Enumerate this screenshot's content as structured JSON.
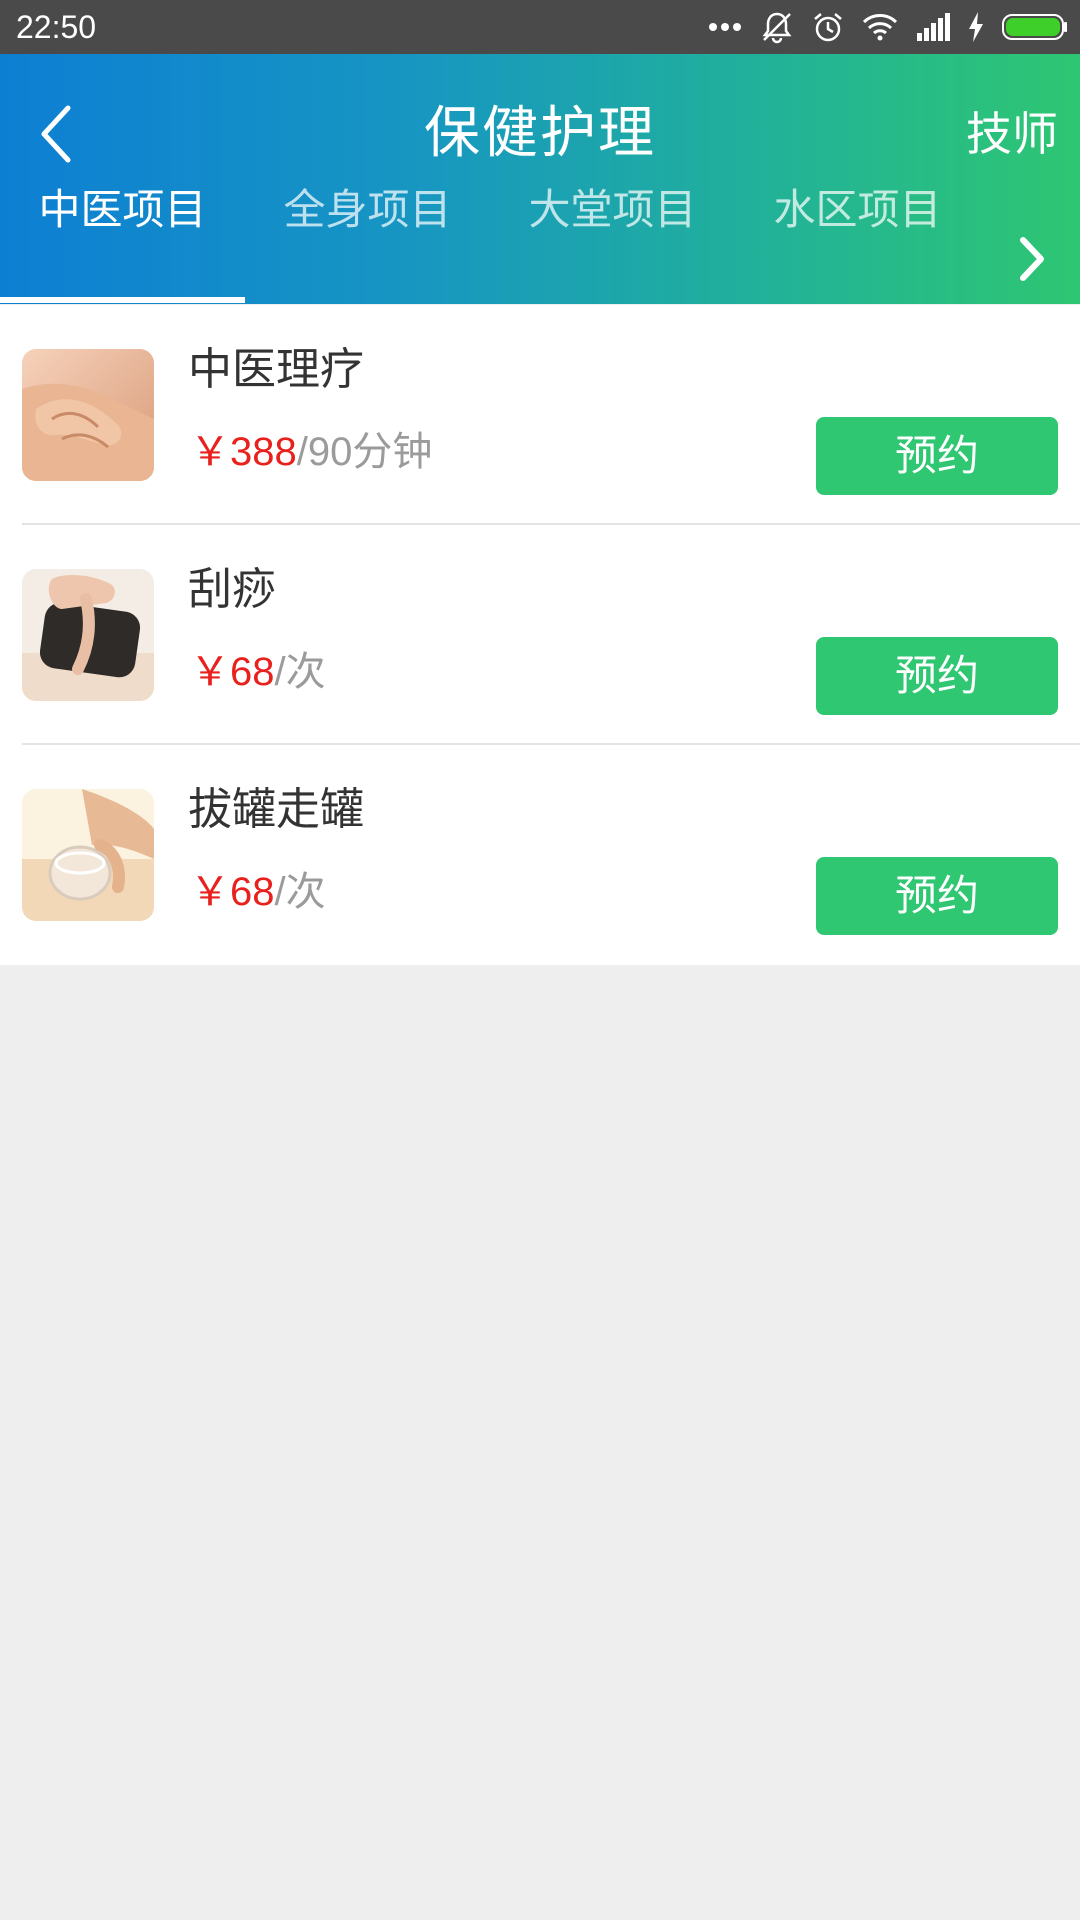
{
  "status_bar": {
    "time": "22:50"
  },
  "header": {
    "title": "保健护理",
    "action_label": "技师"
  },
  "tabs": [
    {
      "label": "中医项目",
      "active": true
    },
    {
      "label": "全身项目",
      "active": false
    },
    {
      "label": "大堂项目",
      "active": false
    },
    {
      "label": "水区项目",
      "active": false
    }
  ],
  "items": [
    {
      "name": "中医理疗",
      "price": "￥388",
      "unit": "/90分钟",
      "button": "预约"
    },
    {
      "name": "刮痧",
      "price": "￥68",
      "unit": "/次",
      "button": "预约"
    },
    {
      "name": "拔罐走罐",
      "price": "￥68",
      "unit": "/次",
      "button": "预约"
    }
  ],
  "colors": {
    "accent_green": "#2fc772",
    "price_red": "#e8211d",
    "header_start": "#0d7fd3",
    "header_end": "#2ec672"
  }
}
